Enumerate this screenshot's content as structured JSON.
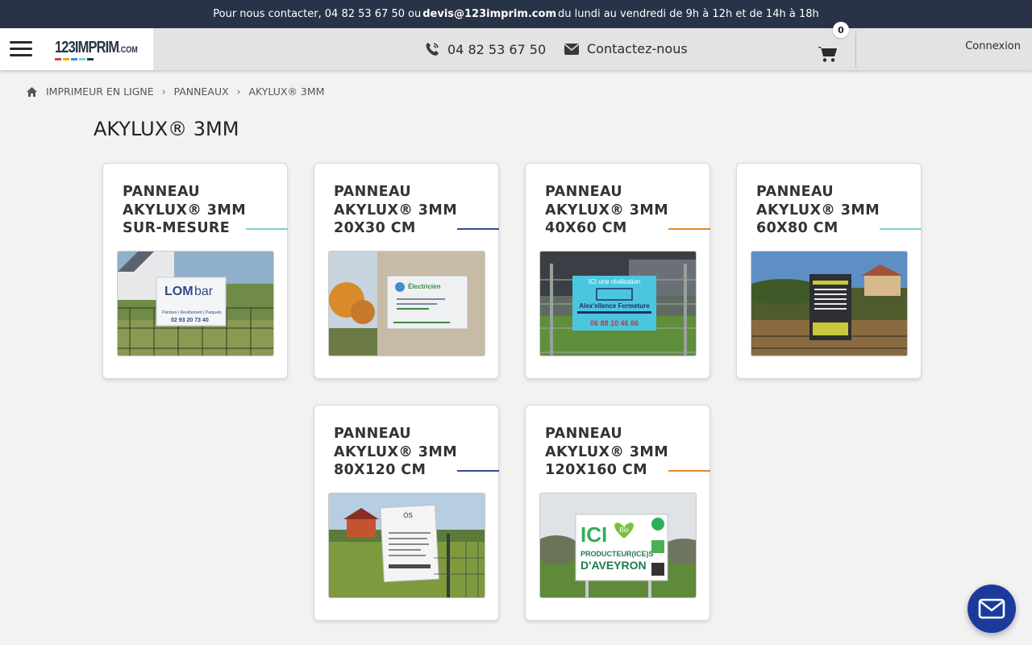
{
  "topbar": {
    "prefix": "Pour nous contacter,",
    "phone": "04 82 53 67 50",
    "or": "ou",
    "email": "devis@123imprim.com",
    "hours": "du lundi au vendredi de 9h à 12h et de 14h à 18h"
  },
  "header": {
    "logo_main": "123IMPRIM",
    "logo_suffix": ".COM",
    "phone": "04 82 53 67 50",
    "contact": "Contactez-nous",
    "cart_count": "0",
    "login": "Connexion"
  },
  "breadcrumb": {
    "items": [
      "IMPRIMEUR EN LIGNE",
      "PANNEAUX",
      "AKYLUX® 3MM"
    ]
  },
  "page_title": "AKYLUX® 3MM",
  "products": [
    {
      "title": "PANNEAU AKYLUX® 3MM SUR-MESURE",
      "accent": "#7fd0cc"
    },
    {
      "title": "PANNEAU AKYLUX® 3MM 20X30 CM",
      "accent": "#2c4f8e"
    },
    {
      "title": "PANNEAU AKYLUX® 3MM 40X60 CM",
      "accent": "#e08a2c"
    },
    {
      "title": "PANNEAU AKYLUX® 3MM 60X80 CM",
      "accent": "#7fd0cc"
    },
    {
      "title": "PANNEAU AKYLUX® 3MM 80X120 CM",
      "accent": "#2c4f8e"
    },
    {
      "title": "PANNEAU AKYLUX® 3MM 120X160 CM",
      "accent": "#e08a2c"
    }
  ],
  "images": {
    "p1": {
      "name": "LOM",
      "name2": "bar",
      "sub": "Peinture | Revêtement | Parquets",
      "phone": "02 93 20 73 40"
    },
    "p2": {
      "name": "Électricien"
    },
    "p3": {
      "line1": "ICI une réalisation",
      "brand": "Alex'ellence Fermeture",
      "phone": "06 88 10 46 86"
    },
    "p6": {
      "big": "ICI",
      "line2": "PRODUCTEUR(ICE)S",
      "line3": "D'AVEYRON",
      "bio": "Bio"
    }
  },
  "colors": {
    "topbar_bg": "#283347",
    "header_bg": "#e3e3e3",
    "chat_button": "#1b3a9c",
    "accent_teal": "#7fd0cc",
    "accent_blue": "#2c4f8e",
    "accent_orange": "#e08a2c"
  },
  "icons": {
    "menu": "hamburger-icon",
    "phone": "phone-icon",
    "mail": "envelope-icon",
    "cart": "cart-icon",
    "home": "home-icon",
    "chevron": "chevron-right-icon",
    "chat": "mail-chat-icon"
  }
}
